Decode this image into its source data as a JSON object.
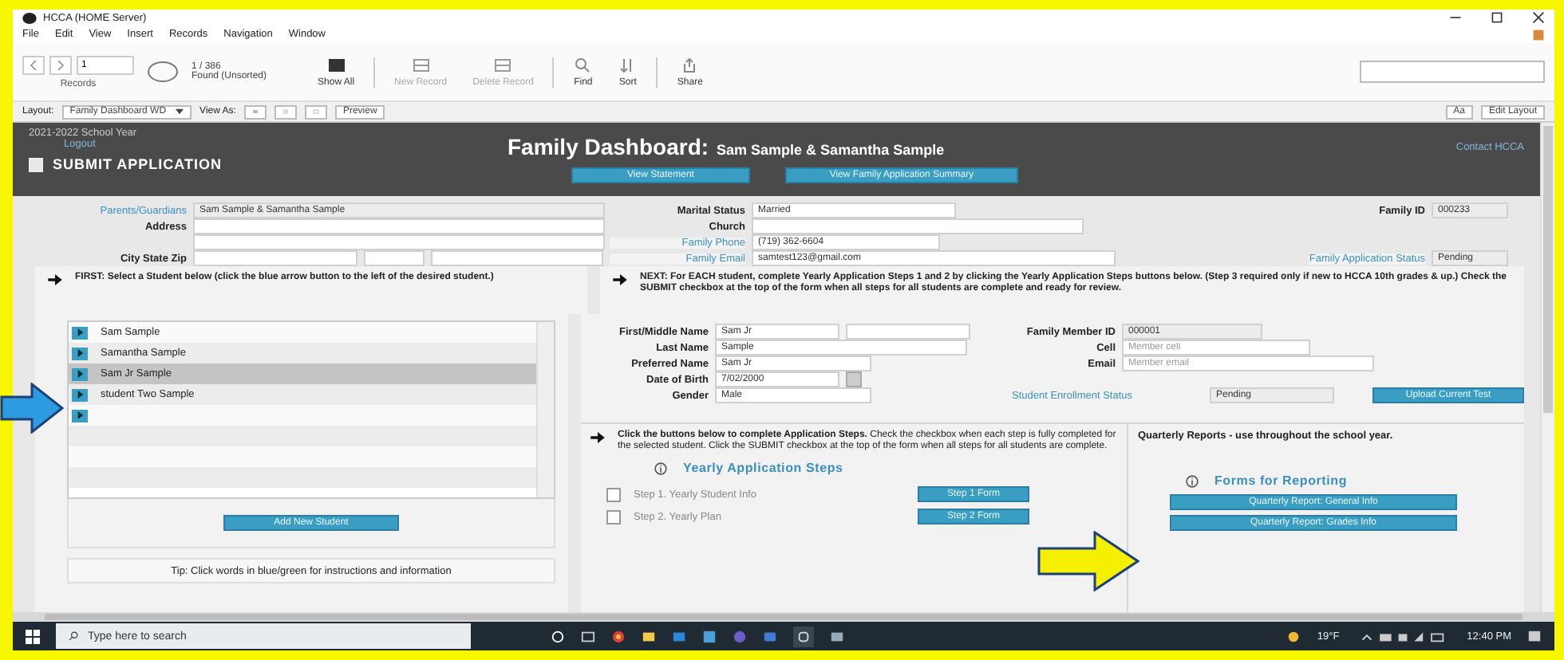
{
  "window": {
    "title": "HCCA (HOME Server)"
  },
  "menu": [
    "File",
    "Edit",
    "View",
    "Insert",
    "Records",
    "Navigation",
    "Window"
  ],
  "toolbar": {
    "record_number": "1",
    "record_count": "1 / 386",
    "found": "Found (Unsorted)",
    "records_label": "Records",
    "tools": [
      {
        "label": "Show All",
        "kind": "showall",
        "disabled": false
      },
      {
        "label": "New Record",
        "kind": "new",
        "disabled": true
      },
      {
        "label": "Delete Record",
        "kind": "delete",
        "disabled": true
      },
      {
        "label": "Find",
        "kind": "find",
        "disabled": false
      },
      {
        "label": "Sort",
        "kind": "sort",
        "disabled": false
      },
      {
        "label": "Share",
        "kind": "share",
        "disabled": false
      }
    ]
  },
  "layout_bar": {
    "layout_label": "Layout:",
    "layout": "Family Dashboard WD",
    "view_as": "View As:",
    "preview": "Preview",
    "text_button": "Aa",
    "edit_layout": "Edit Layout"
  },
  "header": {
    "school_year": "2021-2022 School Year",
    "logout": "Logout",
    "submit": {
      "label": "SUBMIT APPLICATION",
      "checked": false
    },
    "title": "Family Dashboard:",
    "family_name": "Sam Sample & Samantha Sample",
    "buttons": [
      "View Statement",
      "View Family Application Summary"
    ],
    "contact": "Contact HCCA"
  },
  "family": {
    "parents_label": "Parents/Guardians",
    "parents": "Sam Sample & Samantha Sample",
    "address_label": "Address",
    "city_label": "City State Zip",
    "marital_label": "Marital Status",
    "marital": "Married",
    "church_label": "Church",
    "phone_label": "Family Phone",
    "phone": "(719) 362-6604",
    "email_label": "Family Email",
    "email": "samtest123@gmail.com",
    "id_label": "Family ID",
    "id": "000233",
    "status_label": "Family Application Status",
    "status": "Pending"
  },
  "instructions": [
    "FIRST: Select a Student below (click the blue arrow button to the left of the desired student.)",
    "NEXT: For EACH student, complete Yearly Application Steps 1 and 2 by clicking the Yearly Application Steps buttons below. (Step 3 required only if new to HCCA 10th grades & up.) Check the SUBMIT checkbox at the top of the form when all steps for all students are complete and ready for review."
  ],
  "students": [
    {
      "name": "Sam Sample",
      "selected": false
    },
    {
      "name": "Samantha Sample",
      "selected": false
    },
    {
      "name": "Sam Jr Sample",
      "selected": true
    },
    {
      "name": "student Two Sample",
      "selected": false
    },
    {
      "selected": false
    }
  ],
  "add_student": "Add New Student",
  "tip": "Tip: Click words in blue/green for instructions and information",
  "student": {
    "first_label": "First/Middle Name",
    "first": "Sam Jr",
    "last_label": "Last Name",
    "last": "Sample",
    "preferred_label": "Preferred Name",
    "preferred": "Sam Jr",
    "dob_label": "Date of Birth",
    "dob": "7/02/2000",
    "gender_label": "Gender",
    "gender": "Male",
    "member_id_label": "Family Member ID",
    "member_id": "000001",
    "cell_label": "Cell",
    "cell_placeholder": "Member cell",
    "email_label": "Email",
    "email_placeholder": "Member email",
    "enrollment_label": "Student Enrollment Status",
    "enrollment": "Pending",
    "upload": "Upload Current Test"
  },
  "steps": {
    "text": "**Click the buttons below to complete Application Steps.** Check the checkbox when each step is fully completed for the selected student. Click the SUBMIT checkbox at the top of the form when all steps for all students are complete.",
    "heading": "Yearly Application Steps",
    "items": [
      {
        "label": "Step 1. Yearly Student Info",
        "button": "Step 1 Form",
        "checked": false
      },
      {
        "label": "Step 2. Yearly Plan",
        "button": "Step 2 Form",
        "checked": false
      }
    ]
  },
  "quarterly": {
    "text": "Quarterly Reports - use throughout the school year.",
    "heading": "Forms for Reporting",
    "buttons": [
      "Quarterly Report: General Info",
      "Quarterly Report: Grades Info"
    ]
  },
  "taskbar": {
    "search": "Type here to search",
    "weather": "19°F",
    "time": "12:40 PM"
  },
  "annotations": [
    {
      "color": "#2e9be0"
    },
    {
      "color": "#f4f000"
    }
  ]
}
